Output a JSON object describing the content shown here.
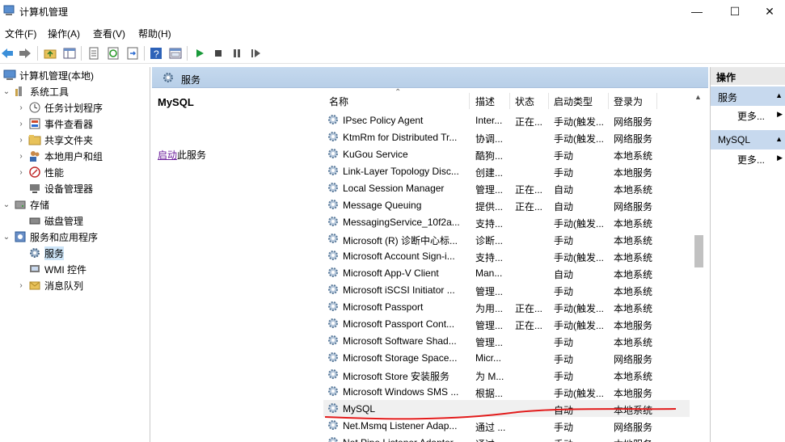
{
  "window": {
    "title": "计算机管理",
    "minimize_glyph": "—",
    "maximize_glyph": "☐",
    "close_glyph": "✕"
  },
  "menu": [
    "文件(F)",
    "操作(A)",
    "查看(V)",
    "帮助(H)"
  ],
  "toolbar": {
    "icons": [
      "back-icon",
      "forward-icon",
      "up-folder-icon",
      "show-tree-icon",
      "properties-icon",
      "refresh-icon",
      "export-icon",
      "help-icon",
      "view-icon",
      "play-icon",
      "stop-icon",
      "pause-icon",
      "resume-icon"
    ]
  },
  "tree": {
    "root": "计算机管理(本地)",
    "system_tools": "系统工具",
    "task_scheduler": "任务计划程序",
    "event_viewer": "事件查看器",
    "shared_folders": "共享文件夹",
    "local_users": "本地用户和组",
    "performance": "性能",
    "device_manager": "设备管理器",
    "storage": "存储",
    "disk_management": "磁盘管理",
    "services_apps": "服务和应用程序",
    "services": "服务",
    "wmi": "WMI 控件",
    "message_queue": "消息队列"
  },
  "center": {
    "header_title": "服务",
    "detail_name": "MySQL",
    "detail_link": "启动",
    "detail_link_suffix": "此服务"
  },
  "columns": {
    "name": "名称",
    "desc": "描述",
    "status": "状态",
    "startup": "启动类型",
    "logon": "登录为"
  },
  "services": [
    {
      "name": "IPsec Policy Agent",
      "desc": "Inter...",
      "status": "正在...",
      "startup": "手动(触发...",
      "logon": "网络服务"
    },
    {
      "name": "KtmRm for Distributed Tr...",
      "desc": "协调...",
      "status": "",
      "startup": "手动(触发...",
      "logon": "网络服务"
    },
    {
      "name": "KuGou Service",
      "desc": "酷狗...",
      "status": "",
      "startup": "手动",
      "logon": "本地系统"
    },
    {
      "name": "Link-Layer Topology Disc...",
      "desc": "创建...",
      "status": "",
      "startup": "手动",
      "logon": "本地服务"
    },
    {
      "name": "Local Session Manager",
      "desc": "管理...",
      "status": "正在...",
      "startup": "自动",
      "logon": "本地系统"
    },
    {
      "name": "Message Queuing",
      "desc": "提供...",
      "status": "正在...",
      "startup": "自动",
      "logon": "网络服务"
    },
    {
      "name": "MessagingService_10f2a...",
      "desc": "支持...",
      "status": "",
      "startup": "手动(触发...",
      "logon": "本地系统"
    },
    {
      "name": "Microsoft (R) 诊断中心标...",
      "desc": "诊断...",
      "status": "",
      "startup": "手动",
      "logon": "本地系统"
    },
    {
      "name": "Microsoft Account Sign-i...",
      "desc": "支持...",
      "status": "",
      "startup": "手动(触发...",
      "logon": "本地系统"
    },
    {
      "name": "Microsoft App-V Client",
      "desc": "Man...",
      "status": "",
      "startup": "自动",
      "logon": "本地系统"
    },
    {
      "name": "Microsoft iSCSI Initiator ...",
      "desc": "管理...",
      "status": "",
      "startup": "手动",
      "logon": "本地系统"
    },
    {
      "name": "Microsoft Passport",
      "desc": "为用...",
      "status": "正在...",
      "startup": "手动(触发...",
      "logon": "本地系统"
    },
    {
      "name": "Microsoft Passport Cont...",
      "desc": "管理...",
      "status": "正在...",
      "startup": "手动(触发...",
      "logon": "本地服务"
    },
    {
      "name": "Microsoft Software Shad...",
      "desc": "管理...",
      "status": "",
      "startup": "手动",
      "logon": "本地系统"
    },
    {
      "name": "Microsoft Storage Space...",
      "desc": "Micr...",
      "status": "",
      "startup": "手动",
      "logon": "网络服务"
    },
    {
      "name": "Microsoft Store 安装服务",
      "desc": "为 M...",
      "status": "",
      "startup": "手动",
      "logon": "本地系统"
    },
    {
      "name": "Microsoft Windows SMS ...",
      "desc": "根据...",
      "status": "",
      "startup": "手动(触发...",
      "logon": "本地服务"
    },
    {
      "name": "MySQL",
      "desc": "",
      "status": "",
      "startup": "自动",
      "logon": "本地系统"
    },
    {
      "name": "Net.Msmq Listener Adap...",
      "desc": "通过 ...",
      "status": "",
      "startup": "手动",
      "logon": "网络服务"
    },
    {
      "name": "Net.Pipe Listener Adapter",
      "desc": "通过 ...",
      "status": "",
      "startup": "手动",
      "logon": "本地服务"
    }
  ],
  "actions": {
    "header": "操作",
    "section1": "服务",
    "more1": "更多...",
    "section2": "MySQL",
    "more2": "更多..."
  },
  "colors": {
    "header_blue": "#c5d9ee",
    "annotation_red": "#e21b1b",
    "link_purple": "#6b1d9b"
  }
}
